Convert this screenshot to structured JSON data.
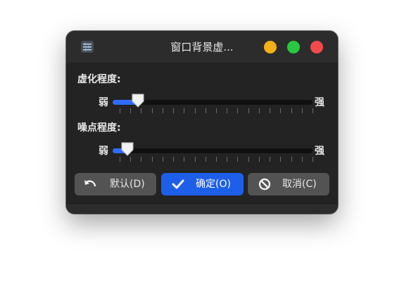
{
  "window": {
    "title": "窗口背景虚..."
  },
  "blur": {
    "label": "虚化程度:",
    "min_label": "弱",
    "max_label": "强",
    "value_fraction": 0.1
  },
  "noise": {
    "label": "噪点程度:",
    "min_label": "弱",
    "max_label": "强",
    "value_fraction": 0.04
  },
  "buttons": {
    "default_label": "默认(D)",
    "ok_label": "确定(O)",
    "cancel_label": "取消(C)"
  },
  "colors": {
    "accent": "#2f6bff",
    "primary_button": "#1d5fe8",
    "minimize": "#f5b015",
    "maximize": "#28c840",
    "close": "#f24a4a"
  },
  "icons": {
    "app": "app-settings-icon",
    "default": "undo-icon",
    "ok": "check-icon",
    "cancel": "no-entry-icon"
  }
}
